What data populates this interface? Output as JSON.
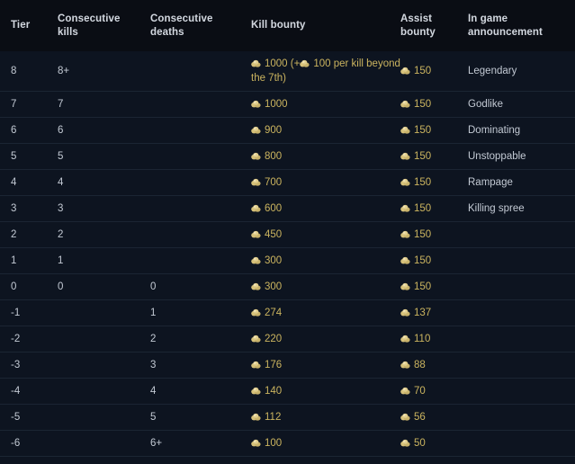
{
  "table": {
    "columns": [
      {
        "key": "tier",
        "label": "Tier"
      },
      {
        "key": "consecutive_kills",
        "label": "Consecutive kills"
      },
      {
        "key": "consecutive_deaths",
        "label": "Consecutive deaths"
      },
      {
        "key": "kill_bounty",
        "label": "Kill bounty"
      },
      {
        "key": "assist_bounty",
        "label": "Assist bounty"
      },
      {
        "key": "announcement",
        "label": "In game announcement"
      }
    ],
    "column_label_lines": {
      "tier": [
        "Tier"
      ],
      "consecutive_kills": [
        "Consecutive",
        "kills"
      ],
      "consecutive_deaths": [
        "Consecutive",
        "deaths"
      ],
      "kill_bounty": [
        "Kill bounty"
      ],
      "assist_bounty": [
        "Assist",
        "bounty"
      ],
      "announcement": [
        "In game",
        "announcement"
      ]
    },
    "icons": {
      "gold": "gold-coin-icon"
    },
    "colors": {
      "gold_text": "#cbb45f",
      "gold_icon": "#d7c27a",
      "header_bg": "#0a0d14",
      "row_bg": "#0d1420",
      "row_border": "#1b2533",
      "body_text": "#c3cad4"
    },
    "rows": [
      {
        "tier": "8",
        "consecutive_kills": "8+",
        "consecutive_deaths": "",
        "kill_bounty_main": "1000",
        "kill_bounty_extra_prefix": "(+",
        "kill_bounty_extra_value": "100",
        "kill_bounty_extra_suffix": "per kill beyond the 7th)",
        "assist_bounty": "150",
        "announcement": "Legendary"
      },
      {
        "tier": "7",
        "consecutive_kills": "7",
        "consecutive_deaths": "",
        "kill_bounty_main": "1000",
        "assist_bounty": "150",
        "announcement": "Godlike"
      },
      {
        "tier": "6",
        "consecutive_kills": "6",
        "consecutive_deaths": "",
        "kill_bounty_main": "900",
        "assist_bounty": "150",
        "announcement": "Dominating"
      },
      {
        "tier": "5",
        "consecutive_kills": "5",
        "consecutive_deaths": "",
        "kill_bounty_main": "800",
        "assist_bounty": "150",
        "announcement": "Unstoppable"
      },
      {
        "tier": "4",
        "consecutive_kills": "4",
        "consecutive_deaths": "",
        "kill_bounty_main": "700",
        "assist_bounty": "150",
        "announcement": "Rampage"
      },
      {
        "tier": "3",
        "consecutive_kills": "3",
        "consecutive_deaths": "",
        "kill_bounty_main": "600",
        "assist_bounty": "150",
        "announcement": "Killing spree"
      },
      {
        "tier": "2",
        "consecutive_kills": "2",
        "consecutive_deaths": "",
        "kill_bounty_main": "450",
        "assist_bounty": "150",
        "announcement": ""
      },
      {
        "tier": "1",
        "consecutive_kills": "1",
        "consecutive_deaths": "",
        "kill_bounty_main": "300",
        "assist_bounty": "150",
        "announcement": ""
      },
      {
        "tier": "0",
        "consecutive_kills": "0",
        "consecutive_deaths": "0",
        "kill_bounty_main": "300",
        "assist_bounty": "150",
        "announcement": ""
      },
      {
        "tier": "-1",
        "consecutive_kills": "",
        "consecutive_deaths": "1",
        "kill_bounty_main": "274",
        "assist_bounty": "137",
        "announcement": ""
      },
      {
        "tier": "-2",
        "consecutive_kills": "",
        "consecutive_deaths": "2",
        "kill_bounty_main": "220",
        "assist_bounty": "110",
        "announcement": ""
      },
      {
        "tier": "-3",
        "consecutive_kills": "",
        "consecutive_deaths": "3",
        "kill_bounty_main": "176",
        "assist_bounty": "88",
        "announcement": ""
      },
      {
        "tier": "-4",
        "consecutive_kills": "",
        "consecutive_deaths": "4",
        "kill_bounty_main": "140",
        "assist_bounty": "70",
        "announcement": ""
      },
      {
        "tier": "-5",
        "consecutive_kills": "",
        "consecutive_deaths": "5",
        "kill_bounty_main": "112",
        "assist_bounty": "56",
        "announcement": ""
      },
      {
        "tier": "-6",
        "consecutive_kills": "",
        "consecutive_deaths": "6+",
        "kill_bounty_main": "100",
        "assist_bounty": "50",
        "announcement": ""
      }
    ]
  }
}
